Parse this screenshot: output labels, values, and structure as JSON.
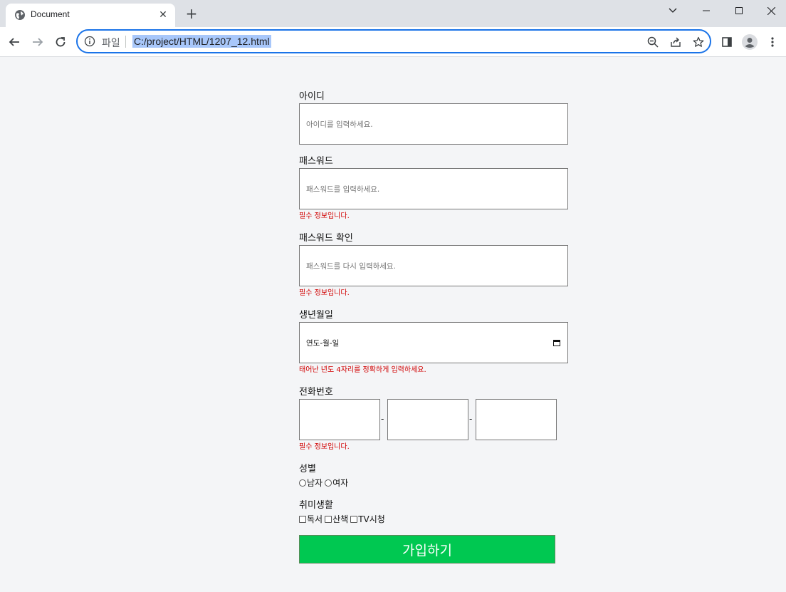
{
  "browser": {
    "tab_title": "Document",
    "new_tab": "+",
    "tab_close": "✕",
    "omnibox": {
      "scheme_label": "파일",
      "url": "C:/project/HTML/1207_12.html"
    }
  },
  "form": {
    "id": {
      "label": "아이디",
      "placeholder": "아이디를 입력하세요."
    },
    "password": {
      "label": "패스워드",
      "placeholder": "패스워드를 입력하세요.",
      "error": "필수 정보입니다."
    },
    "password_confirm": {
      "label": "패스워드 확인",
      "placeholder": "패스워드를 다시 입력하세요.",
      "error": "필수 정보입니다."
    },
    "birth": {
      "label": "생년월일",
      "value": "연도-월-일",
      "error": "태어난 년도 4자리를 정확하게 입력하세요."
    },
    "phone": {
      "label": "전화번호",
      "separator": "-",
      "error": "필수 정보입니다."
    },
    "gender": {
      "label": "성별",
      "options": [
        "남자",
        "여자"
      ]
    },
    "hobby": {
      "label": "취미생활",
      "options": [
        "독서",
        "산책",
        "TV시청"
      ]
    },
    "submit_label": "가입하기"
  },
  "colors": {
    "submit_bg": "#00c851",
    "error_text": "#d10000",
    "focus_ring": "#1a73e8"
  }
}
